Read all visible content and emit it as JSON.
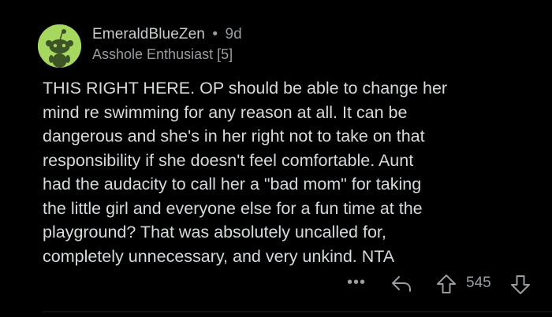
{
  "comment": {
    "author": "EmeraldBlueZen",
    "separator": "•",
    "age": "9d",
    "flair": "Asshole Enthusiast [5]",
    "body": "THIS RIGHT HERE.  OP should be able to change her\nmind re swimming for any reason at all.  It can be\ndangerous and she's in her right not to take on that\nresponsibility if she doesn't feel comfortable. Aunt\nhad the audacity to call her a \"bad mom\" for taking\nthe little girl and everyone else for a fun time at the\nplayground? That was absolutely uncalled for,\ncompletely unnecessary, and very unkind. NTA",
    "avatar_color": "#a6d75f"
  },
  "actions": {
    "more_label": "•••",
    "score": "545",
    "icons": [
      "more-icon",
      "reply-icon",
      "upvote-icon",
      "downvote-icon"
    ]
  },
  "colors": {
    "background": "#000000",
    "text": "#d7dadc",
    "muted": "#9a9da0"
  }
}
